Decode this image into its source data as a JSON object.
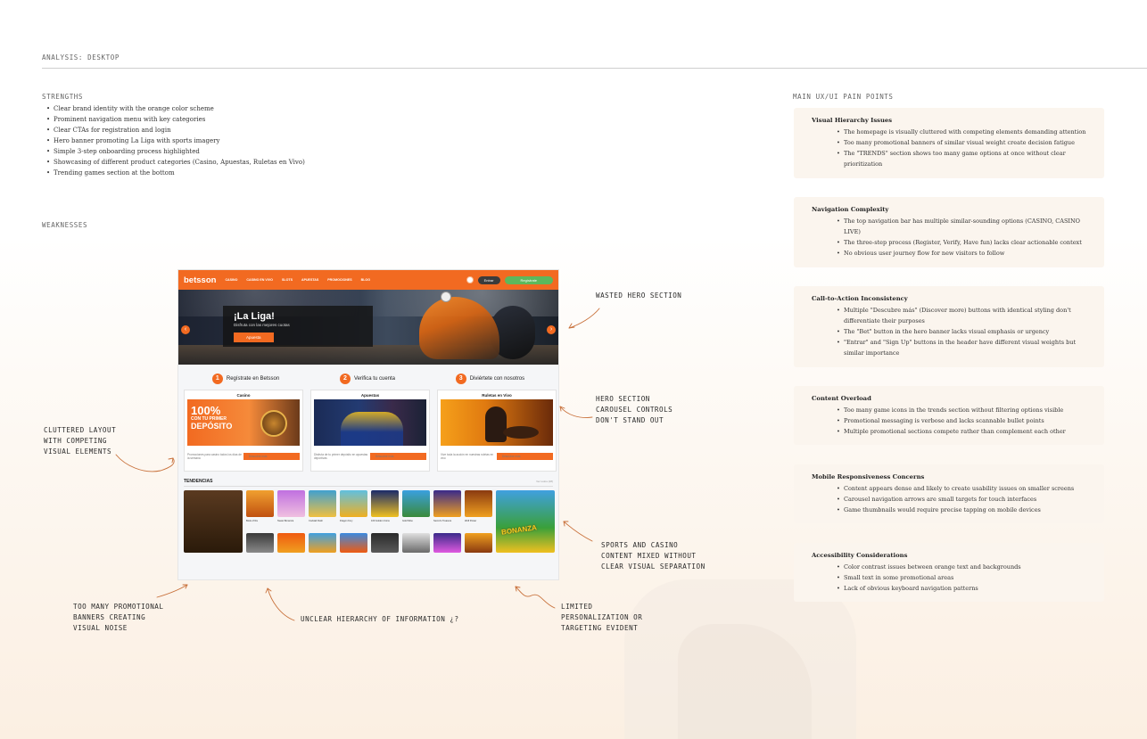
{
  "header": {
    "title": "ANALYSIS: DESKTOP"
  },
  "strengths": {
    "label": "STRENGTHS",
    "items": [
      "Clear brand identity with the orange color scheme",
      "Prominent navigation menu with key categories",
      "Clear CTAs for registration and login",
      "Hero banner promoting La Liga with sports imagery",
      "Simple 3-step onboarding process highlighted",
      "Showcasing of different product categories (Casino, Apuestas, Ruletas en Vivo)",
      "Trending games section at the bottom"
    ]
  },
  "weaknesses": {
    "label": "WEAKNESSES"
  },
  "annotations": {
    "wasted_hero": "WASTED HERO SECTION",
    "carousel": "HERO SECTION\nCAROUSEL CONTROLS\nDON'T STAND OUT",
    "cluttered": "CLUTTERED LAYOUT\nWITH COMPETING\nVISUAL ELEMENTS",
    "mixed": "SPORTS AND CASINO\nCONTENT MIXED WITHOUT\nCLEAR VISUAL SEPARATION",
    "banners": "TOO MANY PROMOTIONAL\nBANNERS CREATING\nVISUAL NOISE",
    "hierarchy": "UNCLEAR HIERARCHY OF INFORMATION ¿?",
    "personalization": "LIMITED\nPERSONALIZATION OR\nTARGETING EVIDENT"
  },
  "pain_points": {
    "label": "MAIN UX/UI PAIN POINTS",
    "cards": [
      {
        "title": "Visual Hierarchy Issues",
        "items": [
          "The homepage is visually cluttered with competing elements demanding attention",
          "Too many promotional banners of similar visual weight create decision fatigue",
          "The \"TRENDS\" section shows too many game options at once without clear prioritization"
        ]
      },
      {
        "title": "Navigation Complexity",
        "items": [
          "The top navigation bar has multiple similar-sounding options (CASINO, CASINO LIVE)",
          "The three-step process (Register, Verify, Have fun) lacks clear actionable context",
          "No obvious user journey flow for new visitors to follow"
        ]
      },
      {
        "title": "Call-to-Action Inconsistency",
        "items": [
          "Multiple \"Descubre más\" (Discover more) buttons with identical styling don't differentiate their purposes",
          "The \"Bet\" button in the hero banner lacks visual emphasis or urgency",
          "\"Entrar\" and \"Sign Up\" buttons in the header have different visual weights but similar importance"
        ]
      },
      {
        "title": "Content Overload",
        "items": [
          "Too many game icons in the trends section without filtering options visible",
          "Promotional messaging is verbose and lacks scannable bullet points",
          "Multiple promotional sections compete rather than complement each other"
        ]
      },
      {
        "title": "Mobile Responsiveness Concerns",
        "items": [
          "Content appears dense and likely to create usability issues on smaller screens",
          "Carousel navigation arrows are small targets for touch interfaces",
          "Game thumbnails would require precise tapping on mobile devices"
        ]
      },
      {
        "title": "Accessibility Considerations",
        "items": [
          "Color contrast issues between orange text and backgrounds",
          "Small text in some promotional areas",
          "Lack of obvious keyboard navigation patterns"
        ]
      }
    ]
  },
  "mockup": {
    "logo": "betsson",
    "nav": [
      "CASINO",
      "CASINO EN VIVO",
      "SLOTS",
      "APUESTAS",
      "PROMOCIONES",
      "BLOG"
    ],
    "entrar": "Entrar",
    "register": "Regístrate",
    "hero_title": "¡La Liga!",
    "hero_sub": "Disfruta con las mejores cuotas",
    "hero_btn": "Apuesta",
    "steps": [
      {
        "num": "1",
        "label": "Regístrate en Betsson"
      },
      {
        "num": "2",
        "label": "Verifica tu cuenta"
      },
      {
        "num": "3",
        "label": "Diviértete con nosotros"
      }
    ],
    "cards": [
      {
        "title": "Casino",
        "text": "Promociones para casino todos los días de la semana",
        "btn": "Descubre más",
        "promo": "100%",
        "promo2": "CON TU PRIMER",
        "promo3": "DEPÓSITO"
      },
      {
        "title": "Apuestas",
        "text": "Disfruta de tu primer depósito en apuestas deportivas",
        "btn": "Descubre más"
      },
      {
        "title": "Ruletas en Vivo",
        "text": "Vive toda la acción en nuestras ruletas en vivo",
        "btn": "Descubre más"
      }
    ],
    "trend_title": "TENDENCIAS",
    "trend_link": "Ver todos (28)",
    "games": [
      "Book of Ra",
      "Sweet Bonanza",
      "Cocktail Rush",
      "Dragon Fury",
      "100 Golden Coins",
      "Gold Mine",
      "Secret's Treasure",
      "Wolf Power"
    ],
    "bonanza": "BONANZA"
  },
  "colors": {
    "brand": "#f26a21",
    "green": "#5cb85c",
    "card_bg": "#fbf5ee"
  }
}
